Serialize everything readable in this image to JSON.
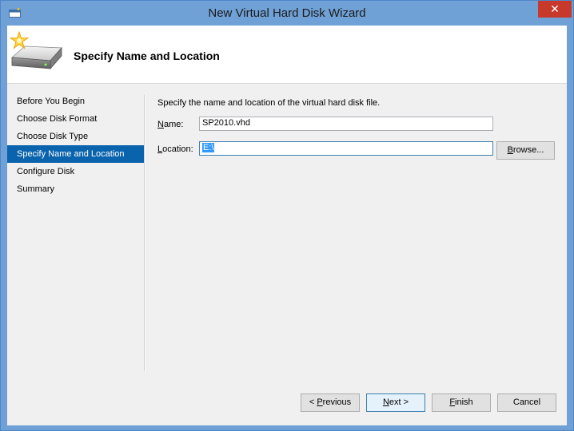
{
  "window": {
    "title": "New Virtual Hard Disk Wizard",
    "close_glyph": "✕"
  },
  "header": {
    "title": "Specify Name and Location",
    "icon": "hard-disk-sparkle-icon"
  },
  "nav": {
    "items": [
      {
        "label": "Before You Begin"
      },
      {
        "label": "Choose Disk Format"
      },
      {
        "label": "Choose Disk Type"
      },
      {
        "label": "Specify Name and Location"
      },
      {
        "label": "Configure Disk"
      },
      {
        "label": "Summary"
      }
    ],
    "selected_index": 3
  },
  "content": {
    "description": "Specify the name and location of the virtual hard disk file.",
    "name_label_mnemonic": "N",
    "name_label_rest": "ame:",
    "name_value": "SP2010.vhd",
    "location_label_mnemonic": "L",
    "location_label_rest": "ocation:",
    "location_value": "E:\\",
    "browse_mnemonic": "B",
    "browse_rest": "rowse..."
  },
  "footer": {
    "previous_prefix": "< ",
    "previous_mnemonic": "P",
    "previous_rest": "revious",
    "next_mnemonic": "N",
    "next_rest": "ext >",
    "finish_mnemonic": "F",
    "finish_rest": "inish",
    "cancel_label": "Cancel"
  },
  "colors": {
    "frame": "#6fa1d6",
    "selection": "#0a64ad",
    "close": "#c7392b"
  }
}
